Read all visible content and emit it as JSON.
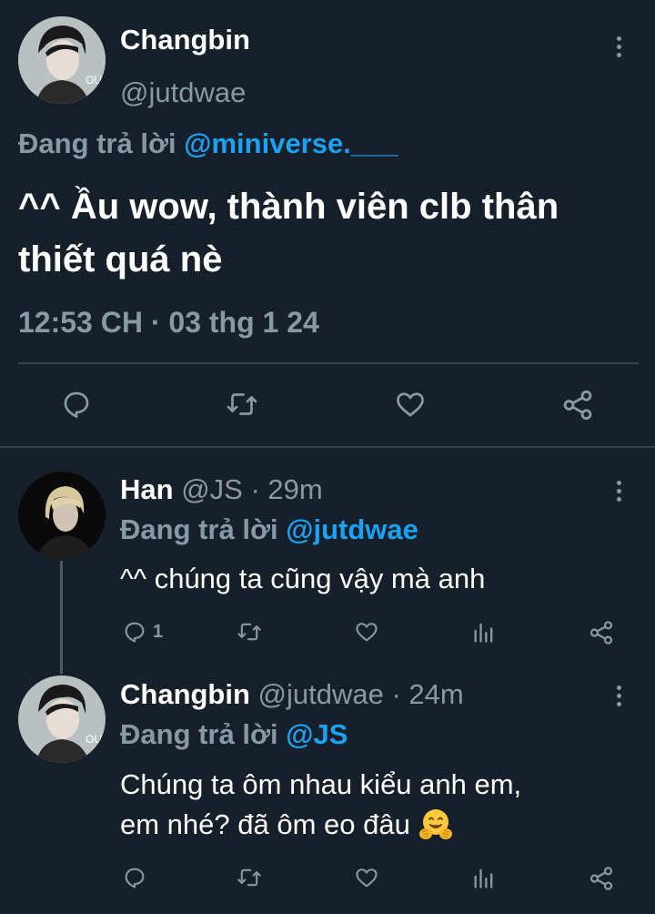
{
  "main_tweet": {
    "name": "Changbin",
    "handle": "@jutdwae",
    "replying_prefix": "Đang trả lời",
    "replying_to": "@miniverse.___",
    "text": "^^ Ầu wow, thành viên clb thân thiết quá nè",
    "timestamp": "12:53 CH · 03 thg 1 24",
    "actions": [
      "reply-icon",
      "retweet-icon",
      "like-icon",
      "share-icon"
    ]
  },
  "replies": [
    {
      "name": "Han",
      "handle": "@JS",
      "time": "· 29m",
      "replying_prefix": "Đang trả lời",
      "replying_to": "@jutdwae",
      "text": "^^ chúng ta cũng vậy mà anh",
      "reply_count": "1",
      "actions": [
        "reply-icon",
        "retweet-icon",
        "like-icon",
        "analytics-icon",
        "share-icon"
      ]
    },
    {
      "name": "Changbin",
      "handle": "@jutdwae",
      "time": "· 24m",
      "replying_prefix": "Đang trả lời",
      "replying_to": "@JS",
      "text_line1": "Chúng ta ôm nhau kiểu anh em,",
      "text_line2": "em nhé? đã ôm eo đâu",
      "emoji": "hugging-face-emoji",
      "reply_count": "",
      "actions": [
        "reply-icon",
        "retweet-icon",
        "like-icon",
        "analytics-icon",
        "share-icon"
      ]
    }
  ],
  "colors": {
    "background": "#15202b",
    "text": "#ffffff",
    "muted": "#8899a6",
    "link": "#1da1f2",
    "divider": "#38444d"
  }
}
